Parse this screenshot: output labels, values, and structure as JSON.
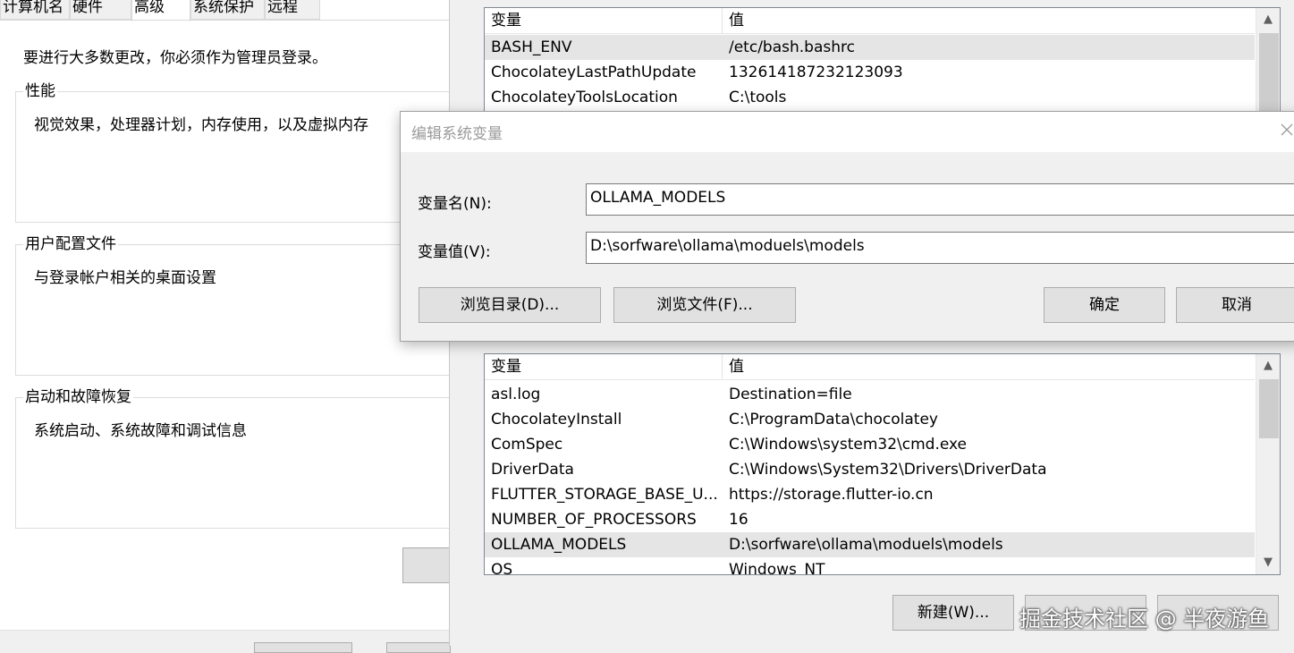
{
  "system_properties": {
    "tabs": [
      "计算机名",
      "硬件",
      "高级",
      "系统保护",
      "远程"
    ],
    "active_tab": "高级",
    "admin_note": "要进行大多数更改，你必须作为管理员登录。",
    "groups": {
      "performance": {
        "title": "性能",
        "description": "视觉效果，处理器计划，内存使用，以及虚拟内存"
      },
      "user_profiles": {
        "title": "用户配置文件",
        "description": "与登录帐户相关的桌面设置"
      },
      "startup_recovery": {
        "title": "启动和故障恢复",
        "description": "系统启动、系统故障和调试信息"
      }
    }
  },
  "user_variables": {
    "header": {
      "name": "变量",
      "value": "值"
    },
    "rows": [
      {
        "name": "BASH_ENV",
        "value": "/etc/bash.bashrc",
        "selected": true
      },
      {
        "name": "ChocolateyLastPathUpdate",
        "value": "132614187232123093",
        "selected": false
      },
      {
        "name": "ChocolateyToolsLocation",
        "value": "C:\\tools",
        "selected": false
      }
    ]
  },
  "edit_dialog": {
    "title": "编辑系统变量",
    "name_label": "变量名(N):",
    "name_value": "OLLAMA_MODELS",
    "value_label": "变量值(V):",
    "value_value": "D:\\sorfware\\ollama\\moduels\\models",
    "browse_dir_label": "浏览目录(D)...",
    "browse_file_label": "浏览文件(F)...",
    "ok_label": "确定",
    "cancel_label": "取消"
  },
  "system_variables": {
    "header": {
      "name": "变量",
      "value": "值"
    },
    "rows": [
      {
        "name": "asl.log",
        "value": "Destination=file",
        "selected": false
      },
      {
        "name": "ChocolateyInstall",
        "value": "C:\\ProgramData\\chocolatey",
        "selected": false
      },
      {
        "name": "ComSpec",
        "value": "C:\\Windows\\system32\\cmd.exe",
        "selected": false
      },
      {
        "name": "DriverData",
        "value": "C:\\Windows\\System32\\Drivers\\DriverData",
        "selected": false
      },
      {
        "name": "FLUTTER_STORAGE_BASE_U...",
        "value": "https://storage.flutter-io.cn",
        "selected": false
      },
      {
        "name": "NUMBER_OF_PROCESSORS",
        "value": "16",
        "selected": false
      },
      {
        "name": "OLLAMA_MODELS",
        "value": "D:\\sorfware\\ollama\\moduels\\models",
        "selected": true
      },
      {
        "name": "OS",
        "value": "Windows_NT",
        "selected": false
      }
    ],
    "new_button": "新建(W)..."
  },
  "watermark": "掘金技术社区 @ 半夜游鱼",
  "icons": {
    "scroll_up": "chevron-up-icon",
    "scroll_down": "chevron-down-icon",
    "close": "close-icon"
  }
}
